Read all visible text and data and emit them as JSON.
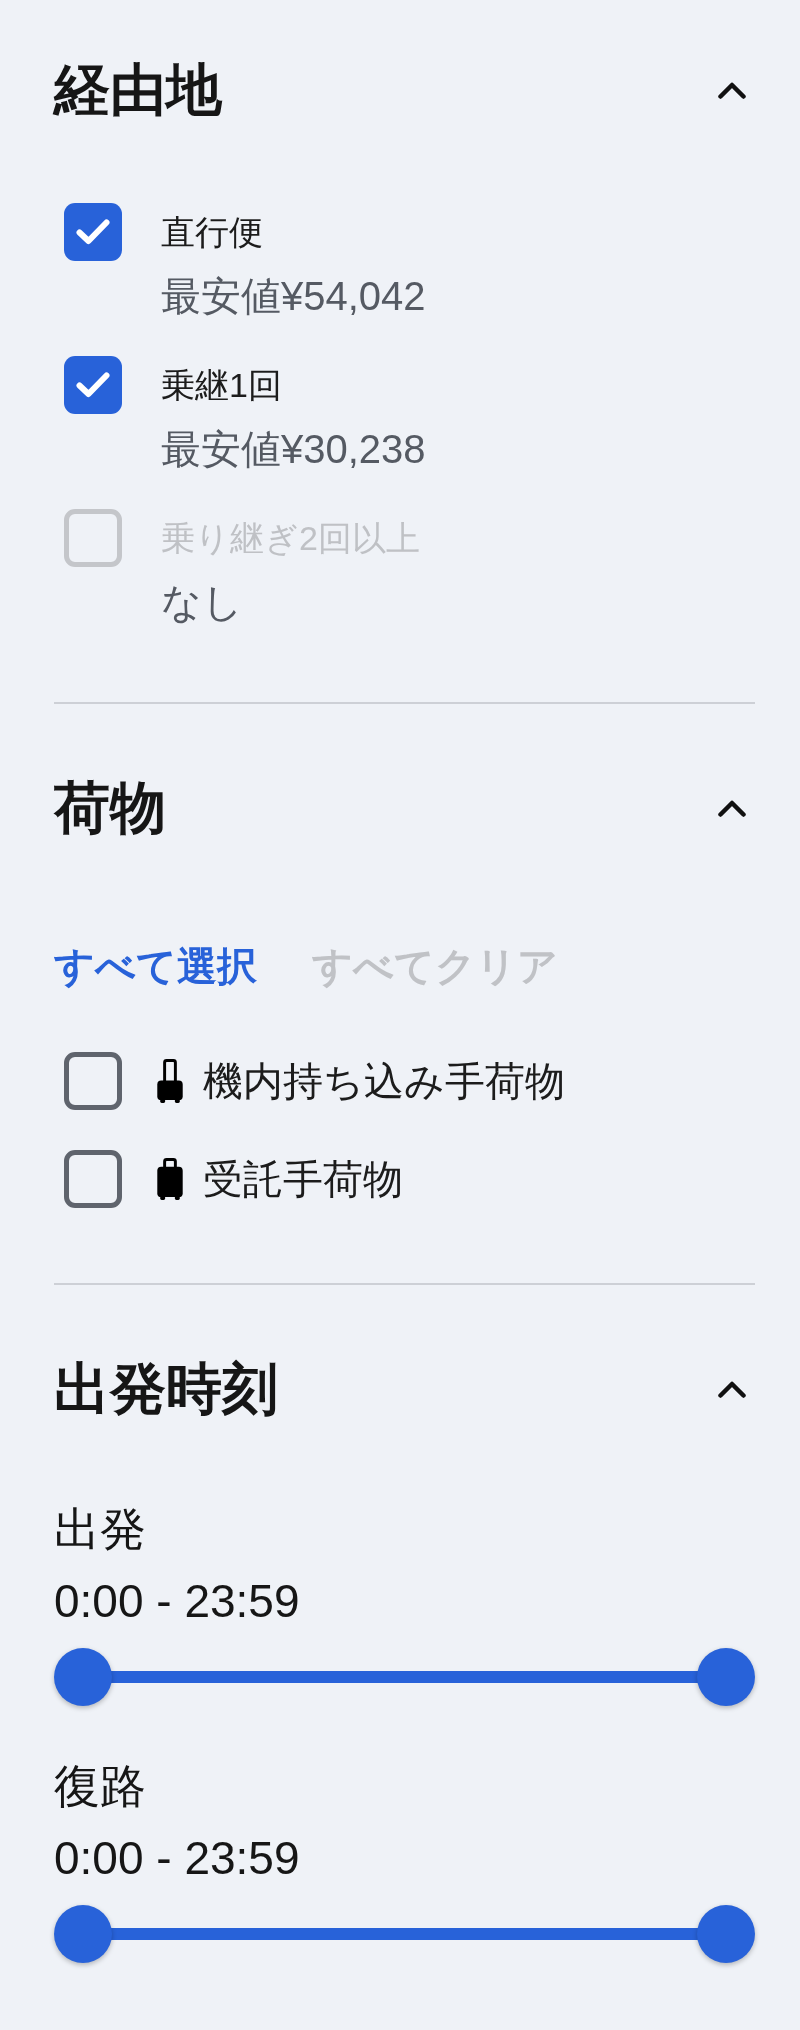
{
  "sections": [
    {
      "kind": "checklist",
      "title": "経由地",
      "expanded": true,
      "options": [
        {
          "label": "直行便",
          "note": "最安値¥54,042",
          "checked": true,
          "disabled": false
        },
        {
          "label": "乗継1回",
          "note": "最安値¥30,238",
          "checked": true,
          "disabled": false
        },
        {
          "label": "乗り継ぎ2回以上",
          "note": "なし",
          "checked": false,
          "disabled": true
        }
      ]
    },
    {
      "kind": "baggage",
      "title": "荷物",
      "expanded": true,
      "actions": [
        {
          "label": "すべて選択",
          "disabled": false
        },
        {
          "label": "すべてクリア",
          "disabled": true
        }
      ],
      "options": [
        {
          "kind": "cabin",
          "label": "機内持ち込み手荷物",
          "checked": false
        },
        {
          "kind": "hold",
          "label": "受託手荷物",
          "checked": false
        }
      ]
    },
    {
      "kind": "sliders",
      "title": "出発時刻",
      "expanded": true,
      "sliders": [
        {
          "label": "出発",
          "reading": "0:00 - 23:59",
          "thumbs": [
            {
              "level": 0
            },
            {
              "level": 1
            }
          ]
        },
        {
          "label": "復路",
          "reading": "0:00 - 23:59",
          "thumbs": [
            {
              "level": 0
            },
            {
              "level": 1
            }
          ]
        }
      ]
    }
  ]
}
